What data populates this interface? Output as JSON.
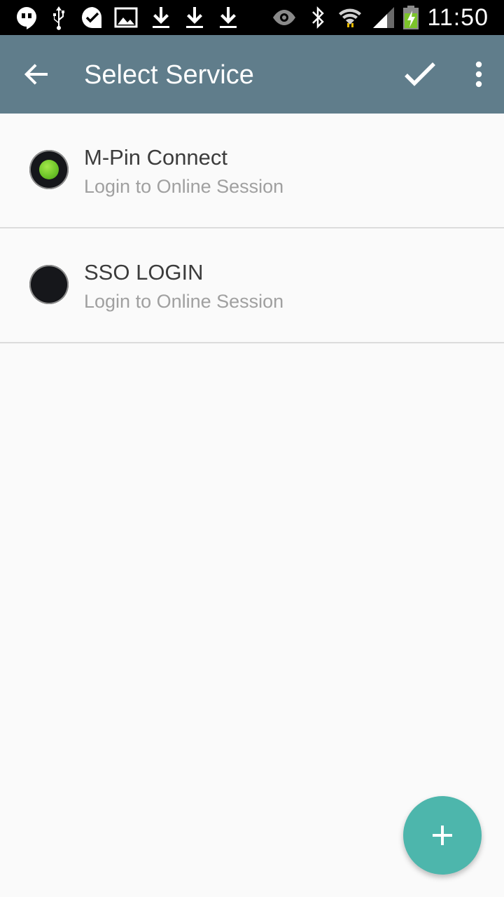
{
  "status_bar": {
    "time": "11:50",
    "icons": [
      "hangouts-icon",
      "usb-icon",
      "check-bubble-icon",
      "image-icon",
      "download-icon",
      "download-icon",
      "download-icon",
      "eye-icon",
      "bluetooth-icon",
      "wifi-icon",
      "signal-icon",
      "battery-charging-icon"
    ]
  },
  "app_bar": {
    "title": "Select Service",
    "back_icon": "arrow-back-icon",
    "confirm_icon": "check-icon",
    "overflow_icon": "more-vert-icon",
    "background_color": "#607d8b"
  },
  "services": [
    {
      "title": "M-Pin Connect",
      "subtitle": "Login to Online Session",
      "selected": true
    },
    {
      "title": "SSO LOGIN",
      "subtitle": "Login to Online Session",
      "selected": false
    }
  ],
  "fab": {
    "icon": "plus-icon",
    "color": "#4db6ac"
  }
}
